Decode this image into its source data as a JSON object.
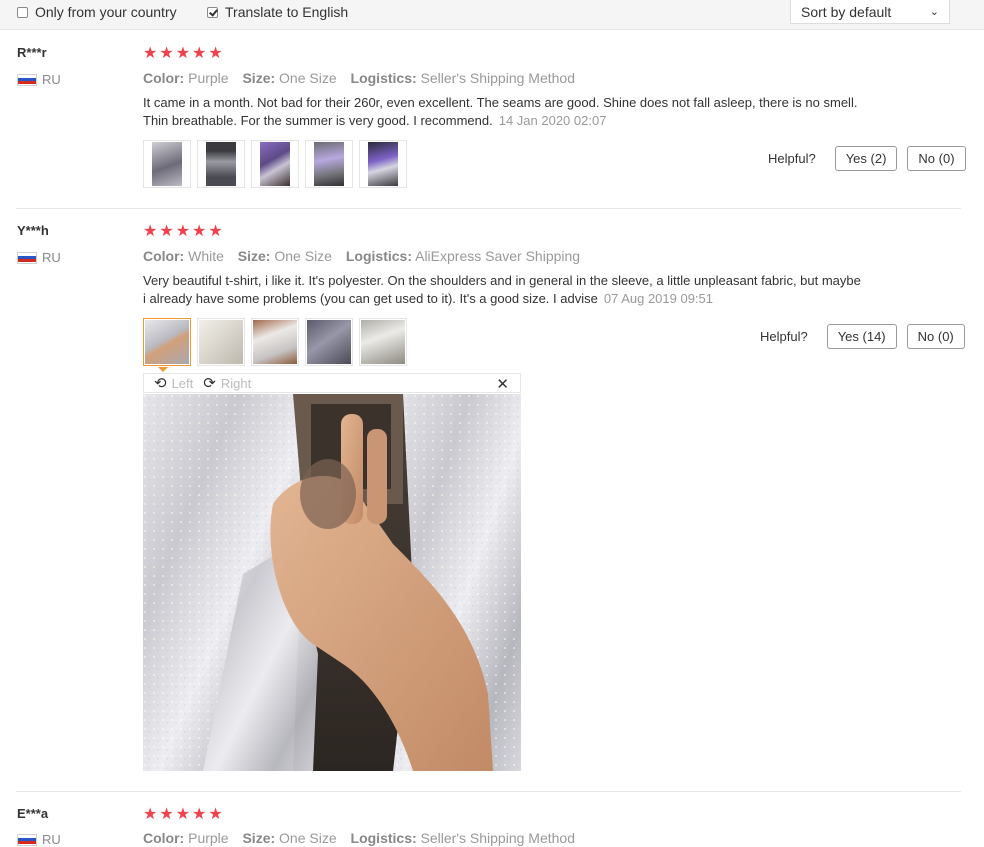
{
  "filters": {
    "only_country_label": "Only from your country",
    "only_country_checked": false,
    "translate_label": "Translate to English",
    "translate_checked": true,
    "sort_value": "Sort by default"
  },
  "labels": {
    "color": "Color:",
    "size": "Size:",
    "logistics": "Logistics:",
    "helpful": "Helpful?"
  },
  "reviews": [
    {
      "user": "R***r",
      "country": "RU",
      "rating": 5,
      "color": "Purple",
      "size": "One Size",
      "logistics": "Seller's Shipping Method",
      "text": "It came in a month. Not bad for their 260r, even excellent. The seams are good. Shine does not fall asleep, there is no smell. Thin breathable. For the summer is very good. I recommend.",
      "date": "14 Jan 2020 02:07",
      "yes": "Yes (2)",
      "no": "No (0)"
    },
    {
      "user": "Y***h",
      "country": "RU",
      "rating": 5,
      "color": "White",
      "size": "One Size",
      "logistics": "AliExpress Saver Shipping",
      "text": "Very beautiful t-shirt, i like it. It's polyester. On the shoulders and in general in the sleeve, a little unpleasant fabric, but maybe i already have some problems (you can get used to it). It's a good size. I advise",
      "date": "07 Aug 2019 09:51",
      "yes": "Yes (14)",
      "no": "No (0)"
    },
    {
      "user": "E***a",
      "country": "RU",
      "rating": 5,
      "color": "Purple",
      "size": "One Size",
      "logistics": "Seller's Shipping Method"
    }
  ],
  "viewer": {
    "left_label": "Left",
    "right_label": "Right",
    "rotate_left_icon": "rotate-left-icon",
    "rotate_right_icon": "rotate-right-icon",
    "close_icon": "close-icon"
  },
  "colors": {
    "star": "#f0414d",
    "active_thumb_border": "#f29a2e"
  }
}
